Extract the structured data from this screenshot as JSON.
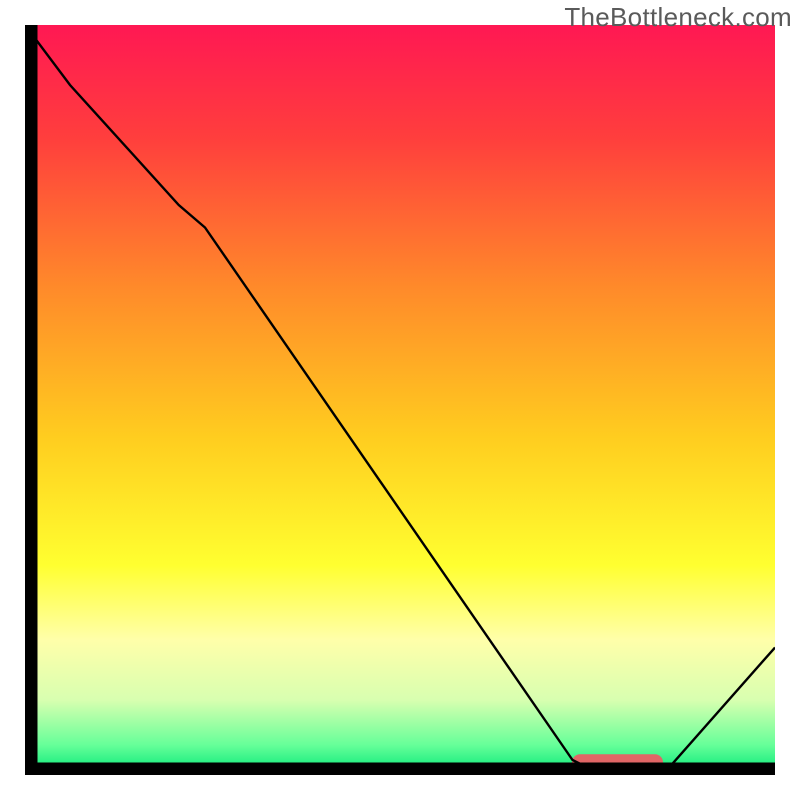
{
  "watermark": "TheBottleneck.com",
  "chart_data": {
    "type": "line",
    "title": "",
    "xlabel": "",
    "ylabel": "",
    "xlim": [
      0,
      100
    ],
    "ylim": [
      0,
      100
    ],
    "legend": null,
    "grid": false,
    "background_gradient": {
      "stops": [
        {
          "offset": 0.0,
          "color": "#ff1853"
        },
        {
          "offset": 0.15,
          "color": "#ff3e3d"
        },
        {
          "offset": 0.35,
          "color": "#ff8a2a"
        },
        {
          "offset": 0.55,
          "color": "#ffcd1f"
        },
        {
          "offset": 0.72,
          "color": "#ffff30"
        },
        {
          "offset": 0.82,
          "color": "#ffffaa"
        },
        {
          "offset": 0.9,
          "color": "#d8ffb0"
        },
        {
          "offset": 0.96,
          "color": "#66ff99"
        },
        {
          "offset": 1.0,
          "color": "#00e676"
        }
      ]
    },
    "curve": {
      "x": [
        0.0,
        6.0,
        20.5,
        24.0,
        73.0,
        77.0,
        85.0,
        100.0
      ],
      "y": [
        100.0,
        92.0,
        76.0,
        73.0,
        2.0,
        0.0,
        0.0,
        17.0
      ]
    },
    "marker_segment": {
      "x_start": 74.0,
      "x_end": 84.0,
      "y": 1.7,
      "color": "#e06666",
      "thickness": 16
    },
    "annotations": []
  }
}
